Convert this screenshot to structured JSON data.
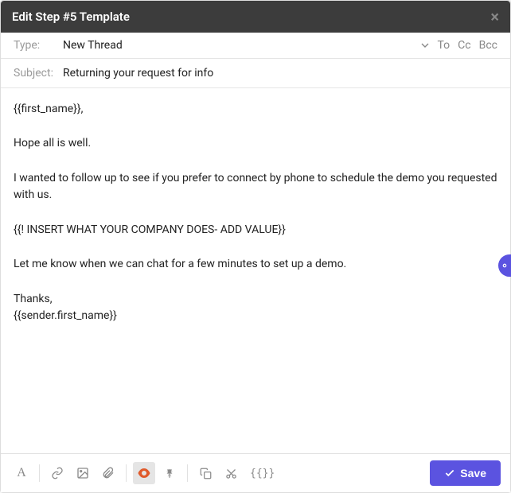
{
  "header": {
    "title": "Edit Step #5 Template"
  },
  "type": {
    "label": "Type:",
    "value": "New Thread"
  },
  "recipients": {
    "to": "To",
    "cc": "Cc",
    "bcc": "Bcc"
  },
  "subject": {
    "label": "Subject:",
    "value": "Returning your request for info"
  },
  "body": {
    "line1": "{{first_name}},",
    "line2": "Hope all is well.",
    "line3": "I wanted to follow up to see if you prefer to connect by phone to schedule the demo you requested with us.",
    "line4": "{{! INSERT WHAT YOUR COMPANY DOES- ADD VALUE}}",
    "line5": "Let me know when we can chat for a few minutes to set up a demo.",
    "line6": "Thanks,",
    "line7": "{{sender.first_name}}"
  },
  "toolbar": {
    "text_format": "A",
    "variables": "{{}}",
    "save_label": "Save"
  }
}
